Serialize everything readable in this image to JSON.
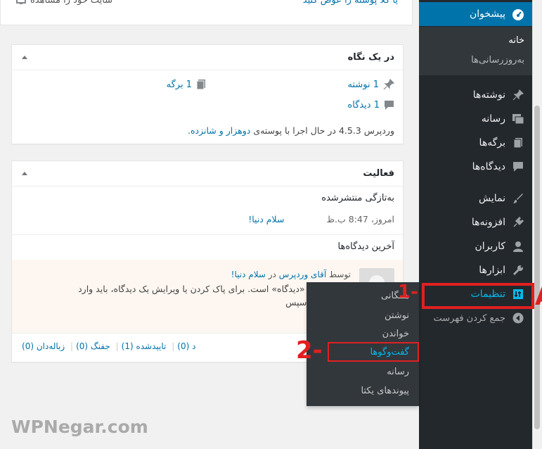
{
  "top_strip": {
    "right_link": "یا کلا پوسته را عوض کنید",
    "left_text": "سایت خود را مشاهده"
  },
  "glance": {
    "title": "در یک نگاه",
    "posts": "1 نوشته",
    "pages": "1 برگه",
    "comments": "1 دیدگاه",
    "footer_prefix": "وردپرس 4.5.3 در حال اجرا با پوسته‌ی",
    "theme_link": "دوهزار و شانزده."
  },
  "activity": {
    "title": "فعالیت",
    "recent_heading": "به‌تازگی منتشرشده",
    "recent_time": "امروز، 8:47 ب.ظ",
    "recent_post": "سلام دنیا!",
    "comments_heading": "آخرین دیدگاه‌ها",
    "comment_by": "توسط",
    "comment_author": "آقای وردپرس",
    "comment_in": "در",
    "comment_post": "سلام دنیا!",
    "comment_line1": "...نوشته یک «دیدگاه» است. برای پاک کردن یا ویرایش یک دیدگاه، باید وارد",
    "comment_line2": "...ت شوید، سپس",
    "filter_pending": "د (0)",
    "filter_approved": "تاییدشده (1)",
    "filter_spam": "جفنگ (0)",
    "filter_trash": "زباله‌دان (0)"
  },
  "sidebar": {
    "dashboard": "پیشخوان",
    "home": "خانه",
    "updates": "به‌روزرسانی‌ها",
    "posts": "نوشته‌ها",
    "media": "رسانه",
    "pages": "برگه‌ها",
    "comments": "دیدگاه‌ها",
    "appearance": "نمایش",
    "plugins": "افزونه‌ها",
    "users": "کاربران",
    "tools": "ابزارها",
    "settings": "تنظیمات",
    "collapse": "جمع کردن فهرست"
  },
  "settings_flyout": {
    "general": "همگانی",
    "writing": "نوشتن",
    "reading": "خواندن",
    "discussion": "گفت‌وگوها",
    "media": "رسانه",
    "permalinks": "پیوندهای یکتا"
  },
  "annotations": {
    "step1": "1-",
    "step2": "2-",
    "letter": "A"
  },
  "watermark": "WPNegar.com",
  "colors": {
    "sidebar_bg": "#23282d",
    "active_blue": "#0073aa",
    "highlight": "#00b9eb",
    "annotation_red": "#e02020"
  }
}
